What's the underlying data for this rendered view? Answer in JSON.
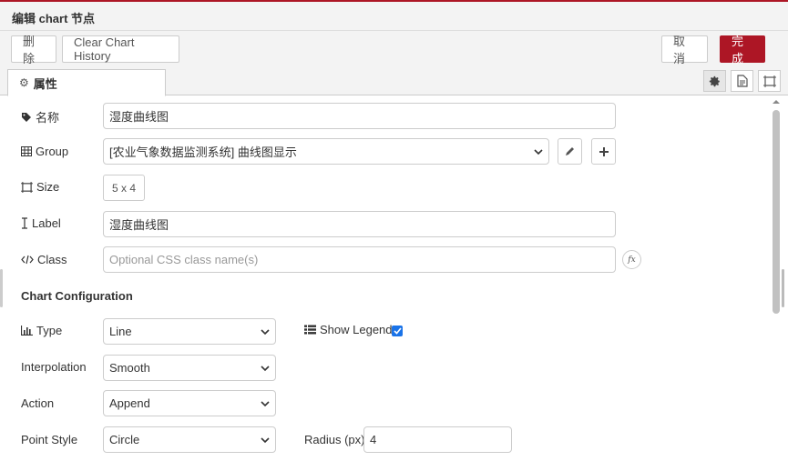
{
  "dialog": {
    "title": "编辑 chart 节点"
  },
  "toolbar": {
    "delete_label": "删除",
    "clear_history_label": "Clear Chart History",
    "cancel_label": "取消",
    "done_label": "完成"
  },
  "tabs": {
    "properties_label": "属性"
  },
  "form": {
    "name_label": "名称",
    "name_value": "湿度曲线图",
    "group_label": "Group",
    "group_value": "[农业气象数据监测系统] 曲线图显示",
    "size_label": "Size",
    "size_value": "5 x 4",
    "label_label": "Label",
    "label_value": "湿度曲线图",
    "class_label": "Class",
    "class_placeholder": "Optional CSS class name(s)",
    "fx_label": "fx"
  },
  "chart_config": {
    "section_title": "Chart Configuration",
    "type_label": "Type",
    "type_value": "Line",
    "show_legend_label": "Show Legend",
    "show_legend_checked": true,
    "interpolation_label": "Interpolation",
    "interpolation_value": "Smooth",
    "action_label": "Action",
    "action_value": "Append",
    "point_style_label": "Point Style",
    "point_style_value": "Circle",
    "radius_label": "Radius (px)",
    "radius_value": "4"
  },
  "colors": {
    "accent": "#ad1625",
    "checkbox": "#1a73e8"
  }
}
